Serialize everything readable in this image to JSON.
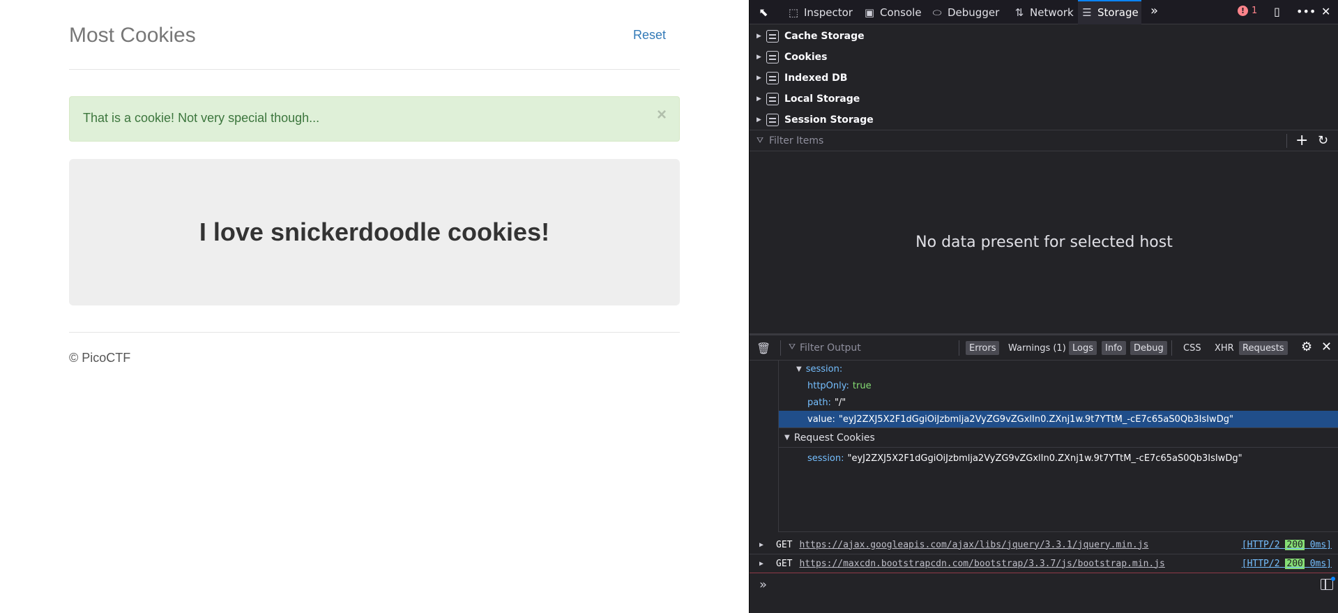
{
  "page": {
    "brand": "Most Cookies",
    "reset_label": "Reset",
    "alert_text": "That is a cookie! Not very special though...",
    "alert_close": "×",
    "jumbotron_heading": "I love snickerdoodle cookies!",
    "footer_text": "© PicoCTF"
  },
  "devtools": {
    "tabs": [
      {
        "label": "Inspector",
        "icon": "inspector-icon",
        "glyph": "⬚"
      },
      {
        "label": "Console",
        "icon": "console-icon",
        "glyph": "▣"
      },
      {
        "label": "Debugger",
        "icon": "debugger-icon",
        "glyph": "⬭"
      },
      {
        "label": "Network",
        "icon": "network-icon",
        "glyph": "⇅"
      },
      {
        "label": "Storage",
        "icon": "storage-icon",
        "glyph": "☰"
      }
    ],
    "active_tab": "Storage",
    "error_count": "1",
    "storage_tree": [
      "Cache Storage",
      "Cookies",
      "Indexed DB",
      "Local Storage",
      "Session Storage"
    ],
    "filter_placeholder": "Filter Items",
    "no_data": "No data present for selected host",
    "console": {
      "filter_placeholder": "Filter Output",
      "chips": [
        {
          "label": "Errors",
          "on": true
        },
        {
          "label": "Warnings (1)",
          "on": false
        },
        {
          "label": "Logs",
          "on": true
        },
        {
          "label": "Info",
          "on": true
        },
        {
          "label": "Debug",
          "on": true
        },
        {
          "label": "CSS",
          "on": false
        },
        {
          "label": "XHR",
          "on": false
        },
        {
          "label": "Requests",
          "on": true
        }
      ]
    },
    "detail": {
      "session_key": "session:",
      "httponly_key": "httpOnly:",
      "httponly_val": "true",
      "path_key": "path:",
      "path_val": "\"/\"",
      "value_key": "value:",
      "value_val": "\"eyJ2ZXJ5X2F1dGgiOiJzbmlja2VyZG9vZGxlIn0.ZXnj1w.9t7YTtM_-cE7c65aS0Qb3IsIwDg\"",
      "request_cookies_label": "Request Cookies",
      "req_session_key": "session:",
      "req_session_val": "\"eyJ2ZXJ5X2F1dGgiOiJzbmlja2VyZG9vZGxlIn0.ZXnj1w.9t7YTtM_-cE7c65aS0Qb3IsIwDg\""
    },
    "requests": [
      {
        "method": "GET",
        "url": "https://ajax.googleapis.com/ajax/libs/jquery/3.3.1/jquery.min.js",
        "proto": "[HTTP/2",
        "status": "200",
        "time": "0ms]"
      },
      {
        "method": "GET",
        "url": "https://maxcdn.bootstrapcdn.com/bootstrap/3.3.7/js/bootstrap.min.js",
        "proto": "[HTTP/2",
        "status": "200",
        "time": "0ms]"
      }
    ],
    "prompt_glyph": "»"
  }
}
